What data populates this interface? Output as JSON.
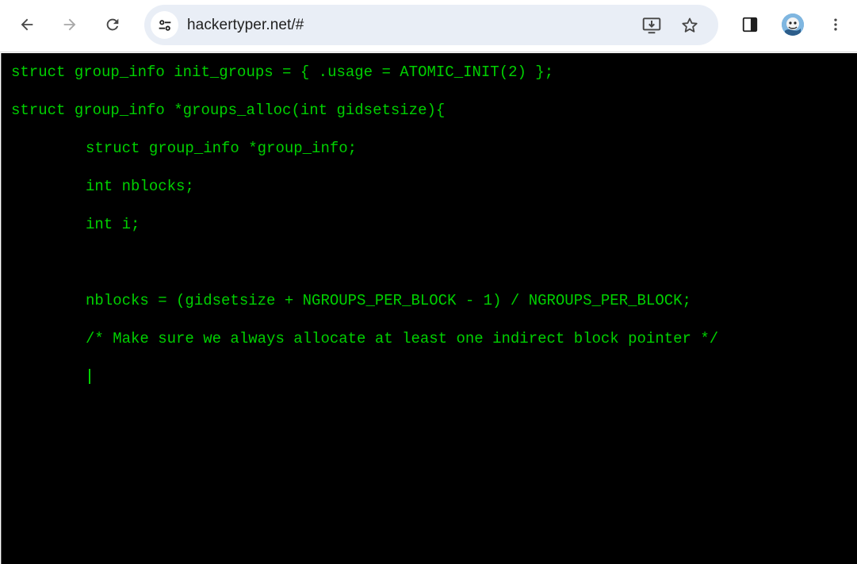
{
  "browser": {
    "url": "hackertyper.net/#",
    "back_icon": "arrow-left-icon",
    "forward_icon": "arrow-right-icon",
    "reload_icon": "reload-icon",
    "site_info_icon": "tune-icon",
    "install_icon": "install-app-icon",
    "bookmark_icon": "star-icon",
    "side_panel_icon": "side-panel-icon",
    "menu_icon": "kebab-menu-icon"
  },
  "code": {
    "color": "#00d000",
    "lines": [
      "struct group_info init_groups = { .usage = ATOMIC_INIT(2) };",
      "struct group_info *groups_alloc(int gidsetsize){",
      "struct group_info *group_info;",
      "int nblocks;",
      "int i;",
      "nblocks = (gidsetsize + NGROUPS_PER_BLOCK - 1) / NGROUPS_PER_BLOCK;",
      "/* Make sure we always allocate at least one indirect block pointer */"
    ]
  }
}
